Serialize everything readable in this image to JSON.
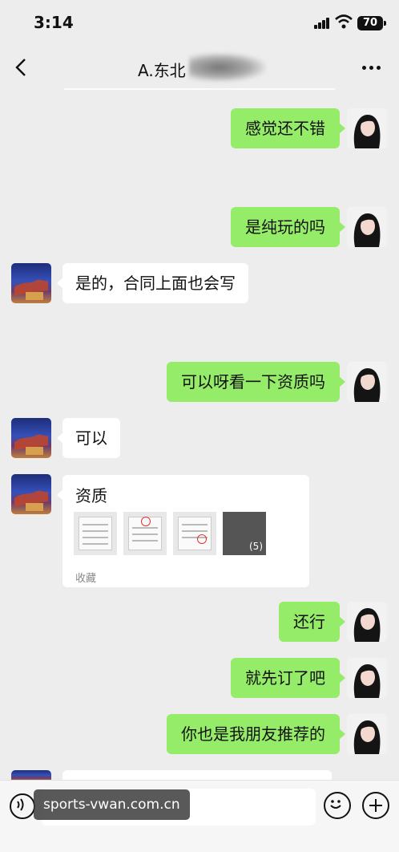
{
  "status_bar": {
    "time": "3:14",
    "battery": "70"
  },
  "header": {
    "title": "A.东北"
  },
  "messages": [
    {
      "side": "out",
      "text": "感觉还不错"
    },
    {
      "side": "out",
      "text": "是纯玩的吗"
    },
    {
      "side": "in",
      "text": "是的，合同上面也会写"
    },
    {
      "side": "out",
      "text": "可以呀看一下资质吗"
    },
    {
      "side": "in",
      "text": "可以"
    },
    {
      "side": "out",
      "text": "还行"
    },
    {
      "side": "out",
      "text": "就先订了吧"
    },
    {
      "side": "out",
      "text": "你也是我朋友推荐的"
    }
  ],
  "card": {
    "title": "资质",
    "image_count": "(5)",
    "footer": "收藏"
  },
  "watermark": "sports-vwan.com.cn",
  "colors": {
    "background": "#ededed",
    "outgoing_bubble": "#95ec69",
    "incoming_bubble": "#ffffff"
  },
  "icons": [
    "back-icon",
    "more-icon",
    "voice-icon",
    "emoji-icon",
    "add-icon"
  ]
}
